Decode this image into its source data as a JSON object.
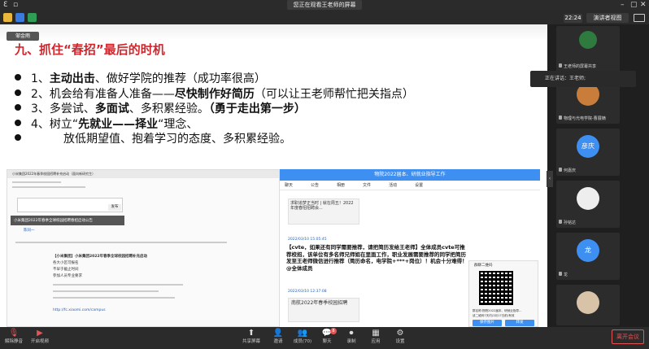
{
  "top": {
    "share_text": "您正在观看王老师的屏幕",
    "clock": "22:24",
    "view_label": "演讲者视图"
  },
  "slide": {
    "speaker_tag": "邹金雨",
    "title": "九、抓住“春招”最后的时机",
    "bullets": [
      {
        "pre": "1、",
        "bold": "主动出击",
        "post": "、做好学院的推荐（成功率很高）",
        "bold2": ""
      },
      {
        "pre": "2、机会给有准备人准备——",
        "bold": "尽快制作好简历",
        "post": "（可以让王老师帮忙把关指点）",
        "bold2": ""
      },
      {
        "pre": "3、多尝试、",
        "bold": "多面试",
        "post": "、多积累经验。",
        "bold2": "（勇于走出第一步）"
      },
      {
        "pre": "4、树立“",
        "bold": "先就业——择业",
        "post": "“理念、",
        "bold2": ""
      },
      {
        "pre": "",
        "bold": "",
        "post": "放低期望值、抱着学习的态度、多积累经验。",
        "bold2": ""
      }
    ]
  },
  "screenshot_left": {
    "header": "小米集团2022年春季校园招聘补充启动（面向新研究生）",
    "comment_line": "小米集团2022年春季全球校园招聘春招启动公告",
    "sign": "陈同一",
    "body_lines": [
      "【小米集团】小米集团2022年春季全球校园招聘补充启动",
      "各大小区可报名",
      "不早于截止时间",
      "参加人员专业要求"
    ],
    "link": "http://fc.xiaomi.com/campus",
    "button": "发布"
  },
  "chat": {
    "title": "物院2022届本、研就业指导工作",
    "tabs": [
      "聊天",
      "公告",
      "相册",
      "文件",
      "活动",
      "设置"
    ],
    "card_title": "求职追梦正当时 | 就在周五！2022年度春招招聘会...",
    "post_time_1": "2022/03/10 15:05:45",
    "post_1": "【cvte，如果还有同学需要推荐，请把简历发给王老师】全体成员cvte可推荐校招，该单位有多名师兄师姐在里面工作，职业发展需要推荐的同学把简历发至王老师微信进行推荐（简历命名，电学院+***+岗位）！机会十分难得！@全体成员",
    "post_time_2": "2022/03/10 12:37:08",
    "card2_title": "南航2022年春季校园招聘",
    "qr_caption": "群聊二维码",
    "qr_group": "群名称:物院2022届本、研就业指导...",
    "qr_note": "该二维码7天内(3月17日前)有效",
    "btn1": "保存图片",
    "btn2": "转发"
  },
  "side": {
    "speaking_now": "正在讲话：王老师;",
    "participants": [
      "王老师的屏幕共享",
      "物理与光电学院-曹展镝",
      "彦庆",
      "何嘉庆",
      "孙铭达",
      "龙",
      "龙"
    ],
    "badge": "彦庆",
    "badge2": "龙"
  },
  "bottom": {
    "mute": "解除静音",
    "video": "开启视频",
    "share": "共享屏幕",
    "invite": "邀请",
    "members": "成员(70)",
    "chat": "聊天",
    "chat_badge": "8",
    "record": "录制",
    "apps": "应用",
    "settings": "设置",
    "leave": "离开会议"
  }
}
